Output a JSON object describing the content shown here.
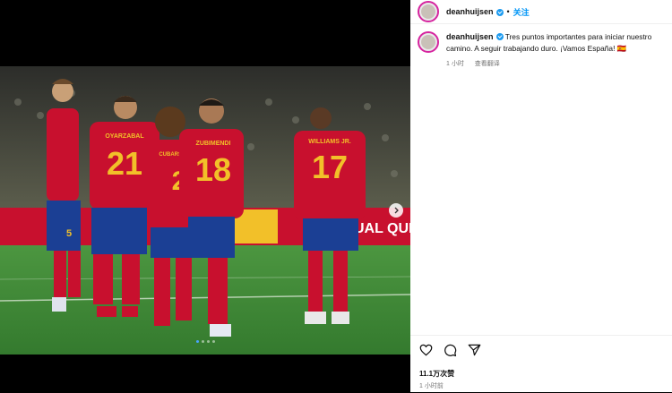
{
  "post": {
    "username": "deanhuijsen",
    "follow_label": "关注",
    "separator": "•",
    "caption": "Tres puntos importantes para iniciar nuestro camino. A seguir trabajando duro. ¡Vamos España! 🇪🇸",
    "caption_time": "1 小时",
    "translate_label": "查看翻译",
    "likes": "11.1万次赞",
    "posted_ago": "1 小时前"
  },
  "photo": {
    "description_icons": [
      "chevron-right-icon"
    ],
    "carousel_dots": 4,
    "active_dot": 1,
    "jerseys": [
      {
        "name": "",
        "number": "5"
      },
      {
        "name": "OYARZABAL",
        "number": "21"
      },
      {
        "name": "CUBARSÍ",
        "number": "2"
      },
      {
        "name": "ZUBIMENDI",
        "number": "18"
      },
      {
        "name": "WILLIAMS JR.",
        "number": "17"
      }
    ],
    "ad_board": "UAL QUI"
  },
  "colors": {
    "jersey_red": "#c8102e",
    "shorts_blue": "#1b3f94",
    "gold": "#f2c029",
    "pitch": "#3f8a36",
    "link_blue": "#0095f6",
    "verified_blue": "#1d9bf0"
  }
}
